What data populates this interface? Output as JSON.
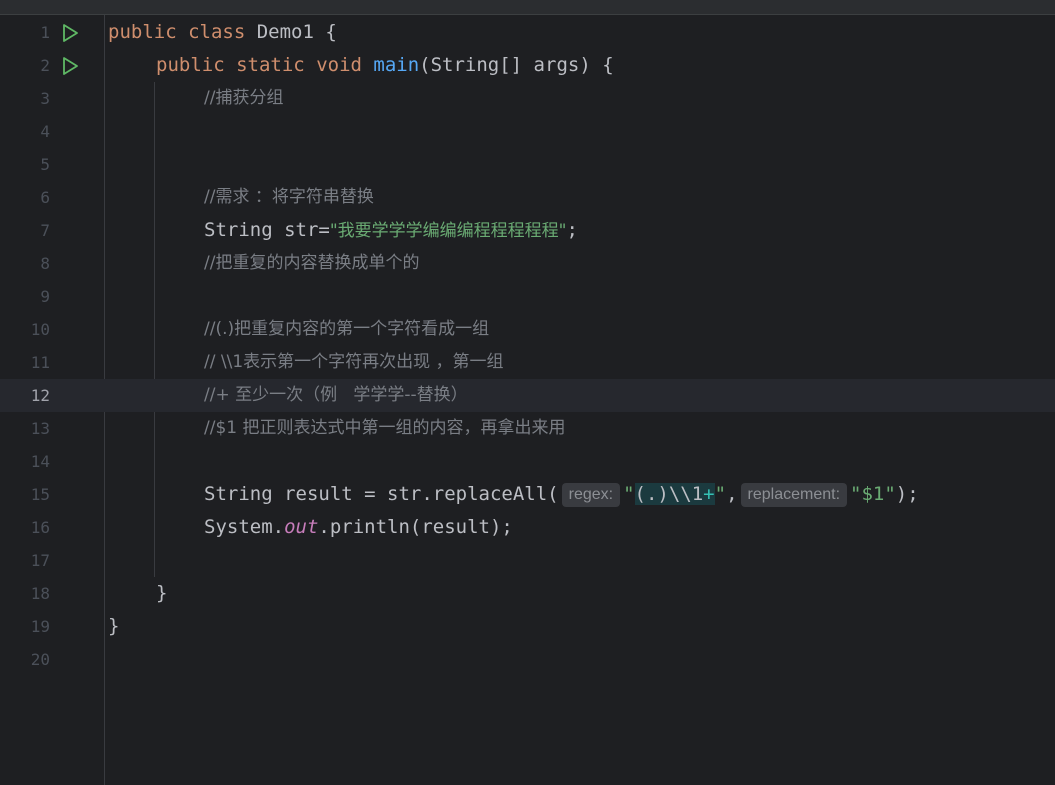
{
  "editor": {
    "current_line": 12,
    "lines": [
      {
        "num": "1"
      },
      {
        "num": "2"
      },
      {
        "num": "3"
      },
      {
        "num": "4"
      },
      {
        "num": "5"
      },
      {
        "num": "6"
      },
      {
        "num": "7"
      },
      {
        "num": "8"
      },
      {
        "num": "9"
      },
      {
        "num": "10"
      },
      {
        "num": "11"
      },
      {
        "num": "12"
      },
      {
        "num": "13"
      },
      {
        "num": "14"
      },
      {
        "num": "15"
      },
      {
        "num": "16"
      },
      {
        "num": "17"
      },
      {
        "num": "18"
      },
      {
        "num": "19"
      },
      {
        "num": "20"
      }
    ],
    "code": {
      "l1_public": "public",
      "l1_class": "class",
      "l1_rest": " Demo1 {",
      "l2_public": "public",
      "l2_static": "static",
      "l2_void": "void",
      "l2_main": "main",
      "l2_rest": "(String[] args) {",
      "l3_comment": "//捕获分组",
      "l6_comment": "//需求 ：将字符串替换",
      "l7_type": "String str=",
      "l7_string": "\"我要学学学编编编程程程程程\"",
      "l7_end": ";",
      "l8_comment": "//把重复的内容替换成单个的",
      "l10_comment": "//(.)把重复内容的第一个字符看成一组",
      "l11_comment": "// \\\\1表示第一个字符再次出现 ，第一组",
      "l12_comment": "//+ 至少一次（例   学学学--替换）",
      "l13_comment": "//$1 把正则表达式中第一组的内容，再拿出来用",
      "l15_start": "String result = str.replaceAll(",
      "l15_hint_regex": "regex:",
      "l15_quote_open": "\"",
      "l15_regex_body": "(.)\\\\1",
      "l15_regex_plus": "+",
      "l15_quote_close": "\"",
      "l15_comma": ",",
      "l15_hint_replacement": "replacement:",
      "l15_repl": "\"$1\"",
      "l15_end": ");",
      "l16_start": "System.",
      "l16_out": "out",
      "l16_end": ".println(result);",
      "l18_brace": "}",
      "l19_brace": "}"
    },
    "run_icon": "run-triangle-icon",
    "colors": {
      "keyword": "#cf8e6d",
      "function": "#56a8f5",
      "comment": "#7a7e85",
      "string": "#6aab73",
      "field": "#c77dbb",
      "run_icon": "#5fb865"
    }
  }
}
